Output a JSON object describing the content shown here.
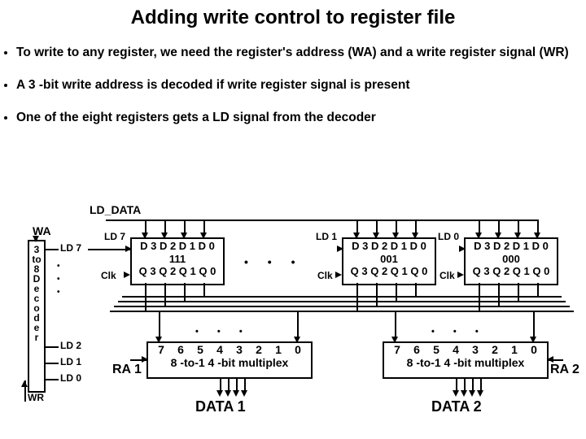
{
  "title": "Adding write control to register file",
  "bullets": [
    "To write to any register, we need the register's address (WA) and a write register signal (WR)",
    "A 3 -bit write address is decoded if write register signal is present",
    "One of the eight registers gets a LD signal from the decoder"
  ],
  "labels": {
    "ld_data": "LD_DATA",
    "wa": "WA",
    "wr": "WR",
    "decoder": "3 to 8 Decoder",
    "ld7": "LD 7",
    "ld2": "LD 2",
    "ld1": "LD 1",
    "ld0": "LD 0",
    "reg_ld7": "LD 7",
    "reg_ld1": "LD 1",
    "reg_ld0": "LD 0",
    "clk": "Clk",
    "d_row": "D 3 D 2 D 1 D 0",
    "q_row": "Q 3 Q 2 Q 1 Q 0",
    "reg7_mid": "111",
    "reg1_mid": "001",
    "reg0_mid": "000",
    "mux_nums": [
      "7",
      "6",
      "5",
      "4",
      "3",
      "2",
      "1",
      "0"
    ],
    "mux_label": "8 -to-1 4 -bit multiplex",
    "ra1": "RA 1",
    "ra2": "RA 2",
    "data1": "DATA 1",
    "data2": "DATA 2"
  }
}
